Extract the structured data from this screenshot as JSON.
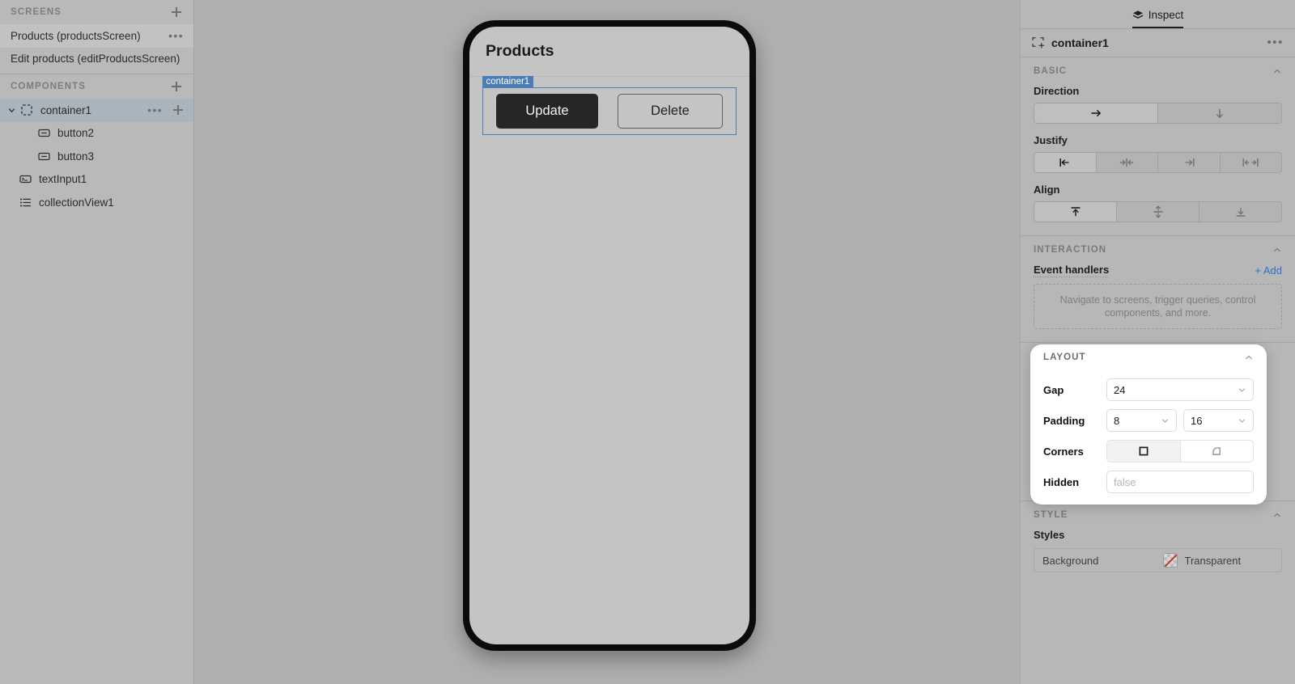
{
  "sidebar": {
    "screens": {
      "title": "SCREENS",
      "add_icon": "plus-icon",
      "items": [
        {
          "label": "Products (productsScreen)",
          "menu": "•••",
          "state": "hovered"
        },
        {
          "label": "Edit products (editProductsScreen)",
          "state": "default"
        }
      ]
    },
    "components": {
      "title": "COMPONENTS",
      "add_icon": "plus-icon",
      "items": [
        {
          "label": "container1",
          "icon": "container-dashed-icon",
          "caret": "chevron-down-icon",
          "menu": "•••",
          "add": "plus-icon",
          "state": "selected",
          "depth": 0
        },
        {
          "label": "button2",
          "icon": "button-icon",
          "depth": 1
        },
        {
          "label": "button3",
          "icon": "button-icon",
          "depth": 1
        },
        {
          "label": "textInput1",
          "icon": "text-input-icon",
          "depth": 0
        },
        {
          "label": "collectionView1",
          "icon": "collection-view-icon",
          "depth": 0
        }
      ]
    }
  },
  "canvas": {
    "phone": {
      "header_title": "Products",
      "selection_tag": "container1",
      "selection_color": "#4a7cb5",
      "buttons": [
        {
          "label": "Update",
          "variant": "filled",
          "name": "button2"
        },
        {
          "label": "Delete",
          "variant": "outlined",
          "name": "button3"
        }
      ]
    }
  },
  "inspector": {
    "tab": {
      "label": "Inspect",
      "icon": "layers-icon",
      "active": true
    },
    "component": {
      "name": "container1",
      "icon": "container-add-icon",
      "menu": "•••"
    },
    "basic": {
      "title": "BASIC",
      "collapse_icon": "chevron-up-icon",
      "direction": {
        "label": "Direction",
        "options": [
          {
            "icon": "arrow-right-icon",
            "value": "horizontal",
            "selected": true
          },
          {
            "icon": "arrow-down-icon",
            "value": "vertical",
            "selected": false
          }
        ]
      },
      "justify": {
        "label": "Justify",
        "options": [
          {
            "icon": "justify-start-icon",
            "value": "start",
            "selected": true
          },
          {
            "icon": "justify-center-icon",
            "value": "center",
            "selected": false
          },
          {
            "icon": "justify-end-icon",
            "value": "end",
            "selected": false
          },
          {
            "icon": "justify-space-between-icon",
            "value": "space-between",
            "selected": false
          }
        ]
      },
      "align": {
        "label": "Align",
        "options": [
          {
            "icon": "align-top-icon",
            "value": "top",
            "selected": true
          },
          {
            "icon": "align-middle-icon",
            "value": "middle",
            "selected": false
          },
          {
            "icon": "align-bottom-icon",
            "value": "bottom",
            "selected": false
          }
        ]
      }
    },
    "interaction": {
      "title": "INTERACTION",
      "collapse_icon": "chevron-up-icon",
      "event_handlers_label": "Event handlers",
      "add_label": "+ Add",
      "add_color": "#2f6fd0",
      "empty_text": "Navigate to screens, trigger queries, control components, and more."
    },
    "layout": {
      "title": "LAYOUT",
      "collapse_icon": "chevron-up-icon",
      "highlighted": true,
      "gap": {
        "label": "Gap",
        "value": "24",
        "chevron": "chevron-down-icon"
      },
      "padding": {
        "label": "Padding",
        "value_vertical": "8",
        "value_horizontal": "16",
        "chevron": "chevron-down-icon"
      },
      "corners": {
        "label": "Corners",
        "options": [
          {
            "icon": "corner-sharp-icon",
            "value": "sharp",
            "selected": true
          },
          {
            "icon": "corner-rounded-icon",
            "value": "rounded",
            "selected": false
          }
        ]
      },
      "hidden": {
        "label": "Hidden",
        "value": "",
        "placeholder": "false"
      }
    },
    "style": {
      "title": "STYLE",
      "collapse_icon": "chevron-up-icon",
      "styles_label": "Styles",
      "background": {
        "key": "Background",
        "value": "Transparent",
        "swatch": "transparent-swatch-icon"
      }
    }
  }
}
